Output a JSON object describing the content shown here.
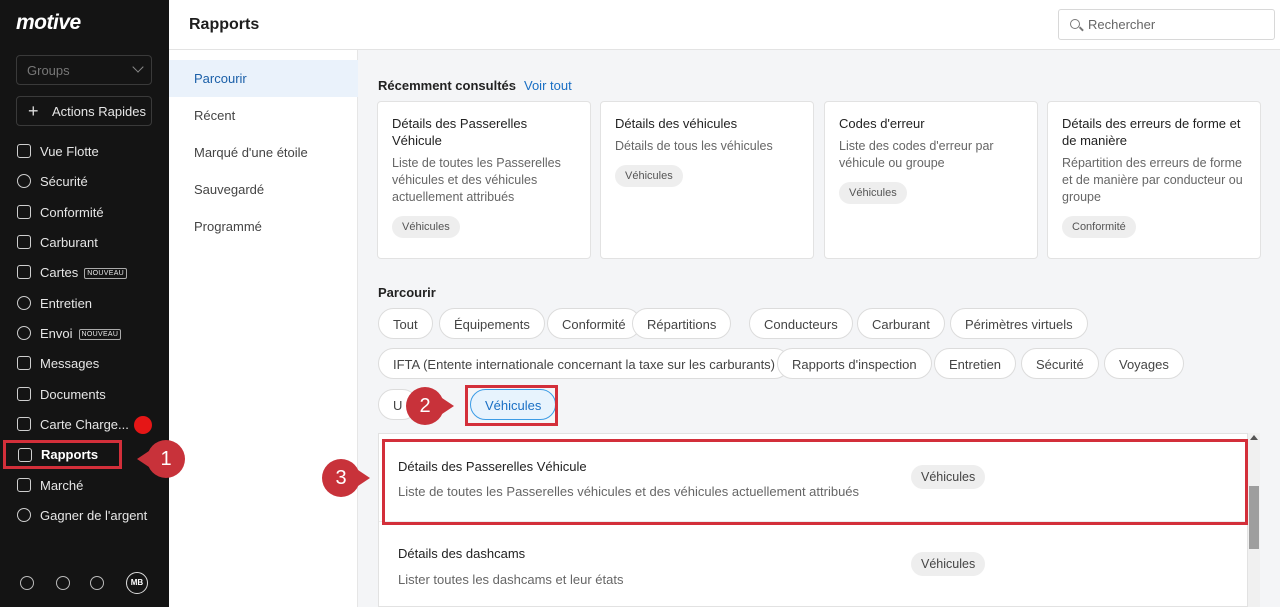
{
  "app": {
    "logo": "motive"
  },
  "sidebar": {
    "groups_placeholder": "Groups",
    "quick_actions": "Actions Rapides",
    "items": [
      {
        "label": "Vue Flotte",
        "icon": "map-icon"
      },
      {
        "label": "Sécurité",
        "icon": "shield-icon"
      },
      {
        "label": "Conformité",
        "icon": "clipboard-icon"
      },
      {
        "label": "Carburant",
        "icon": "fuel-icon"
      },
      {
        "label": "Cartes",
        "icon": "card-icon",
        "badge": "NOUVEAU"
      },
      {
        "label": "Entretien",
        "icon": "wrench-icon"
      },
      {
        "label": "Envoi",
        "icon": "location-pin-icon",
        "badge": "NOUVEAU"
      },
      {
        "label": "Messages",
        "icon": "chat-icon"
      },
      {
        "label": "Documents",
        "icon": "document-icon"
      },
      {
        "label": "Carte Charge...",
        "icon": "charge-card-icon"
      },
      {
        "label": "Rapports",
        "icon": "bar-chart-icon",
        "active": true
      },
      {
        "label": "Marché",
        "icon": "layers-icon"
      },
      {
        "label": "Gagner de l'argent",
        "icon": "dollar-icon"
      }
    ],
    "avatar_initials": "MB"
  },
  "header": {
    "title": "Rapports",
    "search_placeholder": "Rechercher"
  },
  "subnav": {
    "items": [
      "Parcourir",
      "Récent",
      "Marqué d'une étoile",
      "Sauvegardé",
      "Programmé"
    ],
    "active": "Parcourir"
  },
  "recent": {
    "title": "Récemment consultés",
    "separator": "·",
    "view_all": "Voir tout",
    "cards": [
      {
        "title": "Détails des Passerelles Véhicule",
        "desc": "Liste de toutes les Passerelles véhicules et des véhicules actuellement attribués",
        "tag": "Véhicules"
      },
      {
        "title": "Détails des véhicules",
        "desc": "Détails de tous les véhicules",
        "tag": "Véhicules"
      },
      {
        "title": "Codes d'erreur",
        "desc": "Liste des codes d'erreur par véhicule ou groupe",
        "tag": "Véhicules"
      },
      {
        "title": "Détails des erreurs de forme et de manière",
        "desc": "Répartition des erreurs de forme et de manière par conducteur ou groupe",
        "tag": "Conformité"
      }
    ]
  },
  "browse": {
    "title": "Parcourir",
    "chips": [
      "Tout",
      "Équipements",
      "Conformité",
      "Répartitions",
      "Conducteurs",
      "Carburant",
      "Périmètres virtuels",
      "IFTA (Entente internationale concernant la taxe sur les carburants)",
      "Rapports d'inspection",
      "Entretien",
      "Sécurité",
      "Voyages",
      "U",
      "Véhicules"
    ],
    "selected": "Véhicules"
  },
  "results": [
    {
      "title": "Détails des Passerelles Véhicule",
      "desc": "Liste de toutes les Passerelles véhicules et des véhicules actuellement attribués",
      "tag": "Véhicules"
    },
    {
      "title": "Détails des dashcams",
      "desc": "Lister toutes les dashcams et leur états",
      "tag": "Véhicules"
    }
  ],
  "callouts": [
    "1",
    "2",
    "3"
  ],
  "colors": {
    "highlight": "#d32f3a",
    "accent": "#1a6fc4",
    "sidebar_bg": "#141414"
  }
}
